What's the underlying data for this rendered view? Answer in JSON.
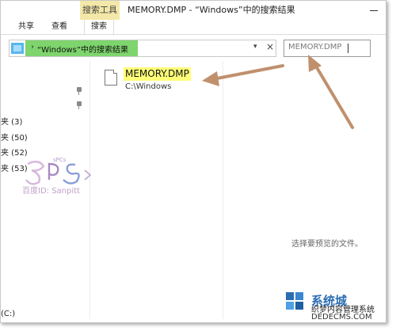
{
  "title": {
    "context_tab": "搜索工具",
    "text": "MEMORY.DMP - “Windows”中的搜索结果"
  },
  "ribbon": {
    "tabs": [
      {
        "label": "共享"
      },
      {
        "label": "查看"
      },
      {
        "label": "搜索"
      }
    ]
  },
  "address": {
    "separator": "›",
    "location": "“Windows”中的搜索结果"
  },
  "search": {
    "query": "MEMORY.DMP"
  },
  "nav": {
    "items": [
      {
        "label": "夹 (3)"
      },
      {
        "label": "夹 (50)"
      },
      {
        "label": "夹 (52)"
      },
      {
        "label": "夹 (53)"
      }
    ],
    "drive": "(C:)"
  },
  "result": {
    "name": "MEMORY.DMP",
    "path": "C:\\Windows"
  },
  "preview": {
    "message": "选择要预览的文件。"
  },
  "watermark": {
    "text": "百度ID: Sanpitt"
  },
  "brand": {
    "top": "系统城",
    "subtitle": "织梦内容管理系统",
    "url": "DEDECMS.COM"
  },
  "colors": {
    "highlight": "#ffff78",
    "address_green": "#7ed56d",
    "arrow": "#c0906d",
    "context_tab": "#f4e8a8"
  }
}
